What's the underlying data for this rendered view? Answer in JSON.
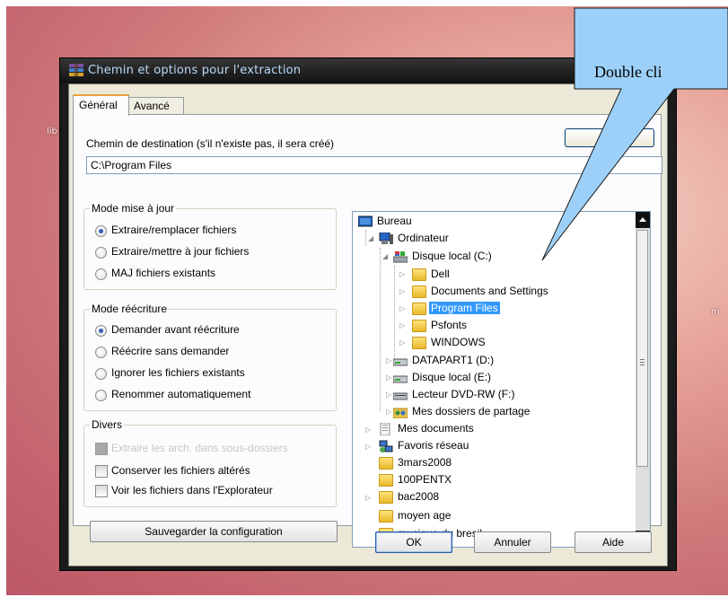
{
  "window": {
    "title": "Chemin et options pour l'extraction"
  },
  "background_labels": {
    "left": "lib",
    "right": "m"
  },
  "tabs": [
    {
      "label": "Général"
    },
    {
      "label": "Avancé"
    }
  ],
  "destination": {
    "label": "Chemin de destination (s'il n'existe pas, il sera créé)",
    "value": "C:\\Program Files"
  },
  "update_mode": {
    "title": "Mode mise à jour",
    "options": [
      {
        "label": "Extraire/remplacer fichiers",
        "selected": true
      },
      {
        "label": "Extraire/mettre à jour fichiers",
        "selected": false
      },
      {
        "label": "MAJ fichiers existants",
        "selected": false
      }
    ]
  },
  "overwrite_mode": {
    "title": "Mode réécriture",
    "options": [
      {
        "label": "Demander avant réécriture",
        "selected": true
      },
      {
        "label": "Réécrire sans demander",
        "selected": false
      },
      {
        "label": "Ignorer les fichiers existants",
        "selected": false
      },
      {
        "label": "Renommer automatiquement",
        "selected": false
      }
    ]
  },
  "misc": {
    "title": "Divers",
    "options": [
      {
        "label": "Extraire les arch. dans sous-dossiers",
        "checked": false,
        "disabled": true
      },
      {
        "label": "Conserver les fichiers altérés",
        "checked": false,
        "disabled": false
      },
      {
        "label": "Voir les fichiers dans l'Explorateur",
        "checked": false,
        "disabled": false
      }
    ]
  },
  "save_config_label": "Sauvegarder la configuration",
  "tree": {
    "items": [
      {
        "label": "Bureau",
        "icon": "desktop-icon"
      },
      {
        "label": "Ordinateur",
        "icon": "computer-icon"
      },
      {
        "label": "Disque local (C:)",
        "icon": "local-disk-icon"
      },
      {
        "label": "Dell",
        "icon": "folder-icon"
      },
      {
        "label": "Documents and Settings",
        "icon": "folder-icon"
      },
      {
        "label": "Program Files",
        "icon": "folder-icon",
        "selected": true
      },
      {
        "label": "Psfonts",
        "icon": "folder-icon"
      },
      {
        "label": "WINDOWS",
        "icon": "folder-icon"
      },
      {
        "label": "DATAPART1 (D:)",
        "icon": "drive-icon"
      },
      {
        "label": "Disque local (E:)",
        "icon": "drive-icon"
      },
      {
        "label": "Lecteur DVD-RW (F:)",
        "icon": "dvd-drive-icon"
      },
      {
        "label": "Mes dossiers de partage",
        "icon": "shared-folder-icon"
      },
      {
        "label": "Mes documents",
        "icon": "documents-icon"
      },
      {
        "label": "Favoris réseau",
        "icon": "network-icon"
      },
      {
        "label": "3mars2008",
        "icon": "folder-icon"
      },
      {
        "label": "100PENTX",
        "icon": "folder-icon"
      },
      {
        "label": "bac2008",
        "icon": "folder-icon"
      },
      {
        "label": "moyen age",
        "icon": "folder-icon"
      },
      {
        "label": "musique du bresil",
        "icon": "folder-icon"
      }
    ]
  },
  "buttons": {
    "ok": "OK",
    "cancel": "Annuler",
    "help": "Aide"
  },
  "callout": {
    "text": "Double cli"
  }
}
